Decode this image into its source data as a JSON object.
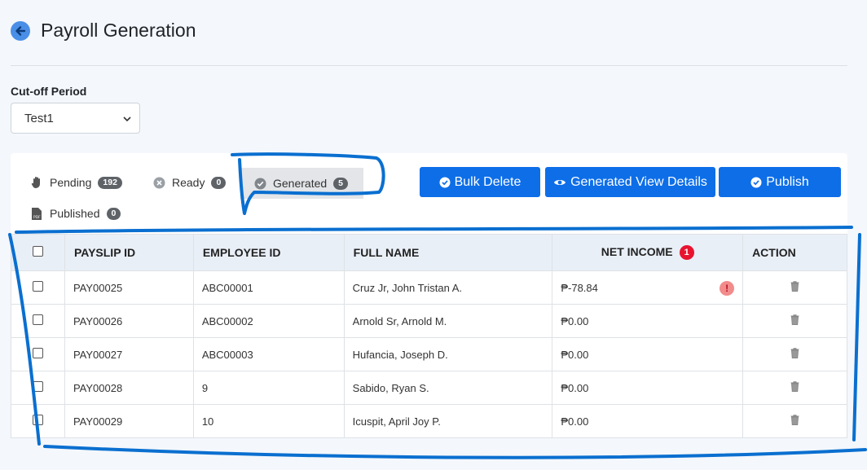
{
  "header": {
    "title": "Payroll Generation"
  },
  "cutoff": {
    "label": "Cut-off Period",
    "selected": "Test1"
  },
  "tabs": [
    {
      "label": "Pending",
      "count": "192",
      "icon": "hand-icon"
    },
    {
      "label": "Ready",
      "count": "0",
      "icon": "x-circle-icon"
    },
    {
      "label": "Generated",
      "count": "5",
      "icon": "check-circle-icon"
    },
    {
      "label": "Published",
      "count": "0",
      "icon": "pdf-icon"
    }
  ],
  "buttons": {
    "bulk_delete": "Bulk Delete",
    "view_details": "Generated View Details",
    "publish": "Publish"
  },
  "table": {
    "headers": [
      "PAYSLIP ID",
      "EMPLOYEE ID",
      "FULL NAME",
      "NET INCOME",
      "ACTION"
    ],
    "net_income_badge": "1",
    "warn_mark": "!",
    "rows": [
      {
        "payslip": "PAY00025",
        "employee": "ABC00001",
        "name": "Cruz Jr, John Tristan A.",
        "net": "₱-78.84"
      },
      {
        "payslip": "PAY00026",
        "employee": "ABC00002",
        "name": "Arnold Sr, Arnold M.",
        "net": "₱0.00"
      },
      {
        "payslip": "PAY00027",
        "employee": "ABC00003",
        "name": "Hufancia, Joseph D.",
        "net": "₱0.00"
      },
      {
        "payslip": "PAY00028",
        "employee": "9",
        "name": "Sabido, Ryan S.",
        "net": "₱0.00"
      },
      {
        "payslip": "PAY00029",
        "employee": "10",
        "name": "Icuspit, April Joy P.",
        "net": "₱0.00"
      }
    ]
  },
  "colors": {
    "primary": "#0d6ee8",
    "badge_red": "#e8132f",
    "annotation": "#0a6fd0"
  }
}
